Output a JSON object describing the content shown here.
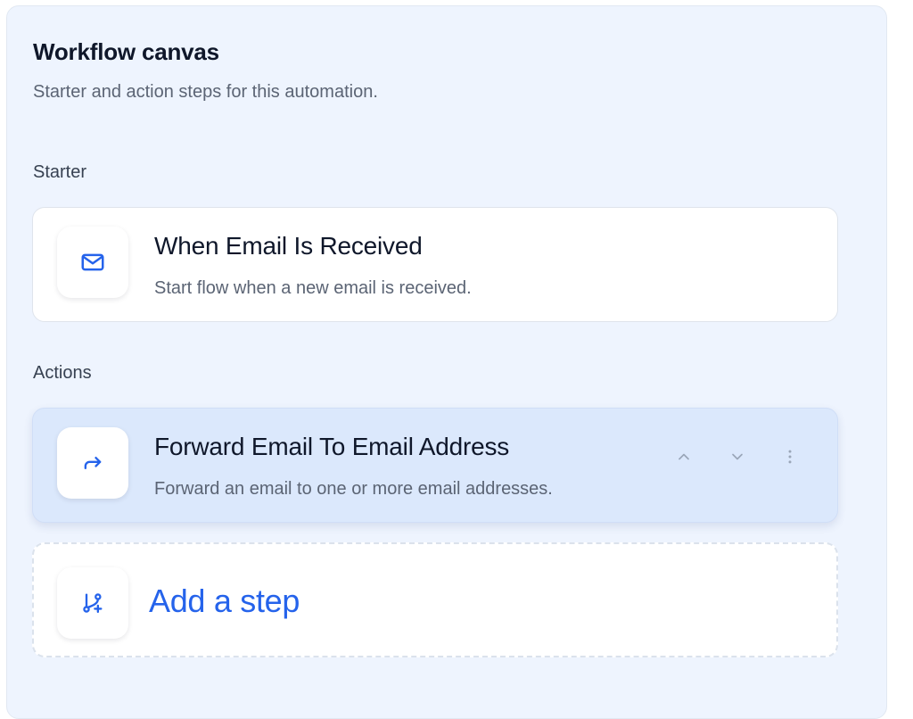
{
  "canvas": {
    "title": "Workflow canvas",
    "subtitle": "Starter and action steps for this automation."
  },
  "starter": {
    "section_label": "Starter",
    "card": {
      "icon": "mail-icon",
      "title": "When Email Is Received",
      "description": "Start flow when a new email is received."
    }
  },
  "actions": {
    "section_label": "Actions",
    "items": [
      {
        "icon": "forward-arrow-icon",
        "title": "Forward Email To Email Address",
        "description": "Forward an email to one or more email addresses."
      }
    ],
    "controls": {
      "move_up_icon": "chevron-up-icon",
      "move_down_icon": "chevron-down-icon",
      "more_icon": "more-vertical-icon"
    }
  },
  "add_step": {
    "icon": "branch-plus-icon",
    "label": "Add a step"
  },
  "colors": {
    "accent": "#2563eb",
    "panel_background": "#eef4fe",
    "active_card_background": "#dbe8fc"
  }
}
